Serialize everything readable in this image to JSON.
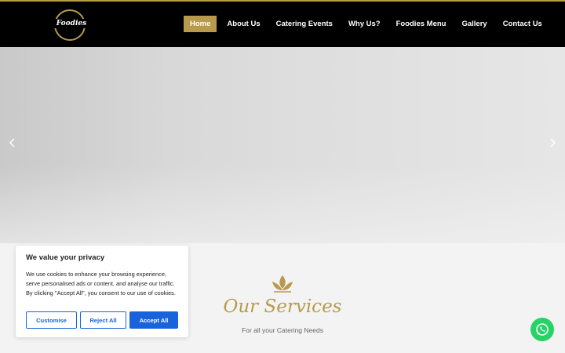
{
  "header": {
    "logo_text": "Foodies",
    "nav": [
      {
        "label": "Home",
        "active": true
      },
      {
        "label": "About Us"
      },
      {
        "label": "Catering Events"
      },
      {
        "label": "Why Us?"
      },
      {
        "label": "Foodies Menu"
      },
      {
        "label": "Gallery"
      },
      {
        "label": "Contact Us"
      }
    ]
  },
  "hero": {
    "prev_icon": "chevron-left-icon",
    "next_icon": "chevron-right-icon"
  },
  "services": {
    "icon": "lotus-icon",
    "title": "Our Services",
    "subtitle": "For all your Catering Needs"
  },
  "cookie_banner": {
    "title": "We value your privacy",
    "text": "We use cookies to enhance your browsing experience, serve personalised ads or content, and analyse our traffic. By clicking \"Accept All\", you consent to our use of cookies.",
    "customise_label": "Customise",
    "reject_label": "Reject All",
    "accept_label": "Accept All"
  },
  "chat": {
    "icon": "whatsapp-icon"
  },
  "colors": {
    "accent": "#b79a4b",
    "cookie_blue": "#1863dc",
    "whatsapp_green": "#25d366"
  }
}
